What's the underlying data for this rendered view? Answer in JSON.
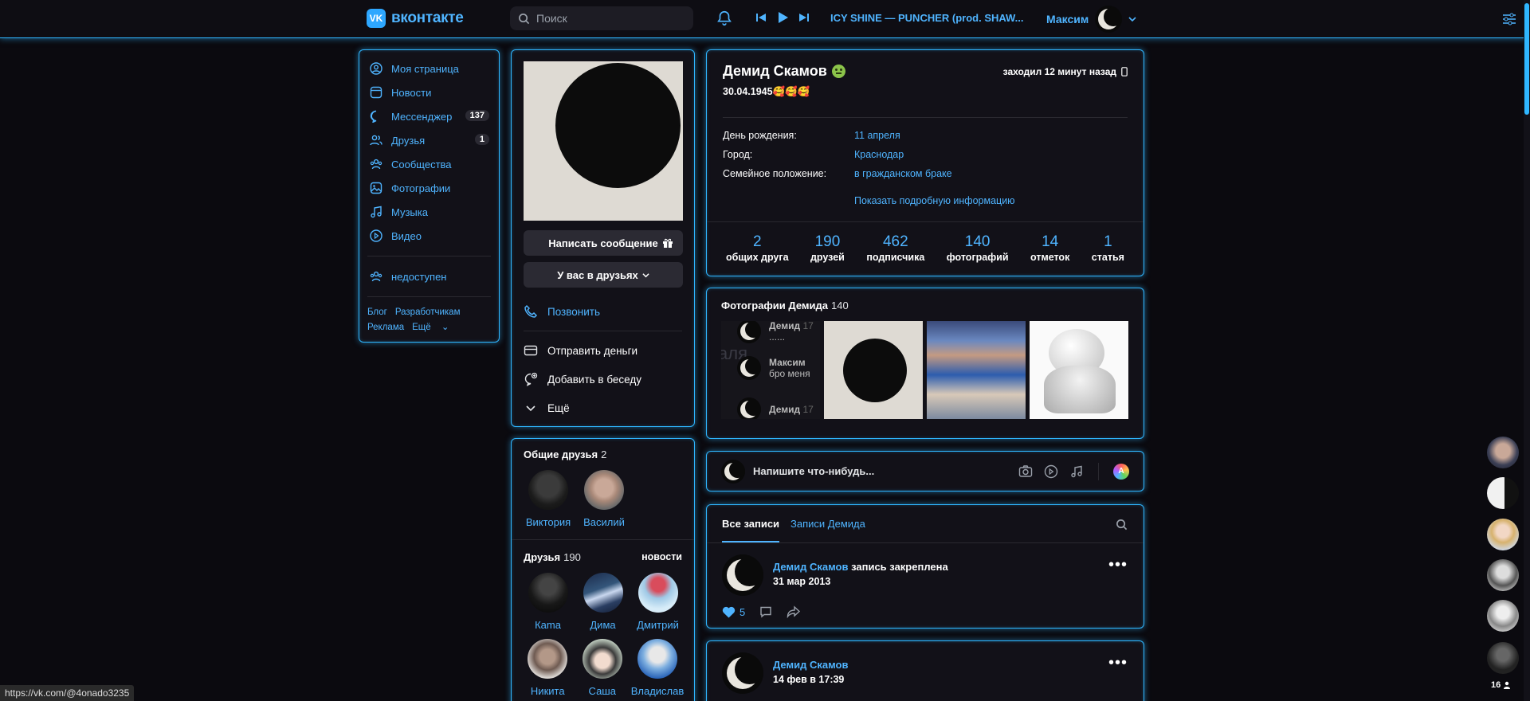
{
  "header": {
    "logo_text": "вконтакте",
    "logo_mark": "VK",
    "search_placeholder": "Поиск",
    "track": "ICY SHINE — PUNCHER (prod. SHAW...",
    "user_name": "Максим"
  },
  "sidebar": {
    "items": [
      {
        "label": "Моя страница",
        "icon": "user-circle-icon"
      },
      {
        "label": "Новости",
        "icon": "news-icon"
      },
      {
        "label": "Мессенджер",
        "icon": "message-icon",
        "badge": "137"
      },
      {
        "label": "Друзья",
        "icon": "friends-icon",
        "badge": "1"
      },
      {
        "label": "Сообщества",
        "icon": "groups-icon"
      },
      {
        "label": "Фотографии",
        "icon": "photo-icon"
      },
      {
        "label": "Музыка",
        "icon": "music-icon"
      },
      {
        "label": "Видео",
        "icon": "video-icon"
      }
    ],
    "extra_item": "недоступен",
    "footer": {
      "blog": "Блог",
      "dev": "Разработчикам",
      "ads": "Реклама",
      "more": "Ещё"
    }
  },
  "avatar_card": {
    "write_message": "Написать сообщение",
    "in_friends": "У вас в друзьях",
    "call": "Позвонить",
    "send_money": "Отправить деньги",
    "add_to_chat": "Добавить в беседу",
    "more": "Ещё"
  },
  "mutual_friends": {
    "title": "Общие друзья",
    "count": "2",
    "items": [
      {
        "name": "Виктория"
      },
      {
        "name": "Василий"
      }
    ]
  },
  "friends": {
    "title": "Друзья",
    "count": "190",
    "news_link": "новости",
    "items": [
      {
        "name": "Кama"
      },
      {
        "name": "Дима"
      },
      {
        "name": "Дмитрий"
      },
      {
        "name": "Никита"
      },
      {
        "name": "Саша"
      },
      {
        "name": "Владислав"
      }
    ]
  },
  "profile": {
    "name": "Демид Скамов",
    "last_seen": "заходил 12 минут назад",
    "status": "30.04.1945🥰🥰🥰",
    "info": [
      {
        "label": "День рождения:",
        "value": "11 апреля"
      },
      {
        "label": "Город:",
        "value": "Краснодар"
      },
      {
        "label": "Семейное положение:",
        "value": "в гражданском браке"
      }
    ],
    "show_more": "Показать подробную информацию",
    "counters": [
      {
        "num": "2",
        "label": "общих друга"
      },
      {
        "num": "190",
        "label": "друзей"
      },
      {
        "num": "462",
        "label": "подписчика"
      },
      {
        "num": "140",
        "label": "фотографий"
      },
      {
        "num": "14",
        "label": "отметок"
      },
      {
        "num": "1",
        "label": "статья"
      }
    ]
  },
  "photos": {
    "title": "Фотографии Демида",
    "count": "140",
    "thumb1_lines": [
      "Демид",
      "......",
      "Максим",
      "бро меня",
      "Демид"
    ],
    "thumb1_bg_text": "аля",
    "thumb1_time": "17"
  },
  "compose": {
    "placeholder": "Напишите что-нибудь..."
  },
  "posts": {
    "tab_all": "Все записи",
    "tab_own": "Записи Демида",
    "post1": {
      "author": "Демид Скамов",
      "action": "запись закреплена",
      "date": "31 мар 2013",
      "likes": "5"
    },
    "post2": {
      "author": "Демид Скамов",
      "date": "14 фев в 17:39"
    }
  },
  "rail": {
    "online_count": "16"
  },
  "status_bar": {
    "url": "https://vk.com/@4onado3235"
  },
  "colors": {
    "accent": "#2fb6ff",
    "link": "#4fb4ff",
    "bg": "#0b0a0f",
    "card": "#121118"
  }
}
